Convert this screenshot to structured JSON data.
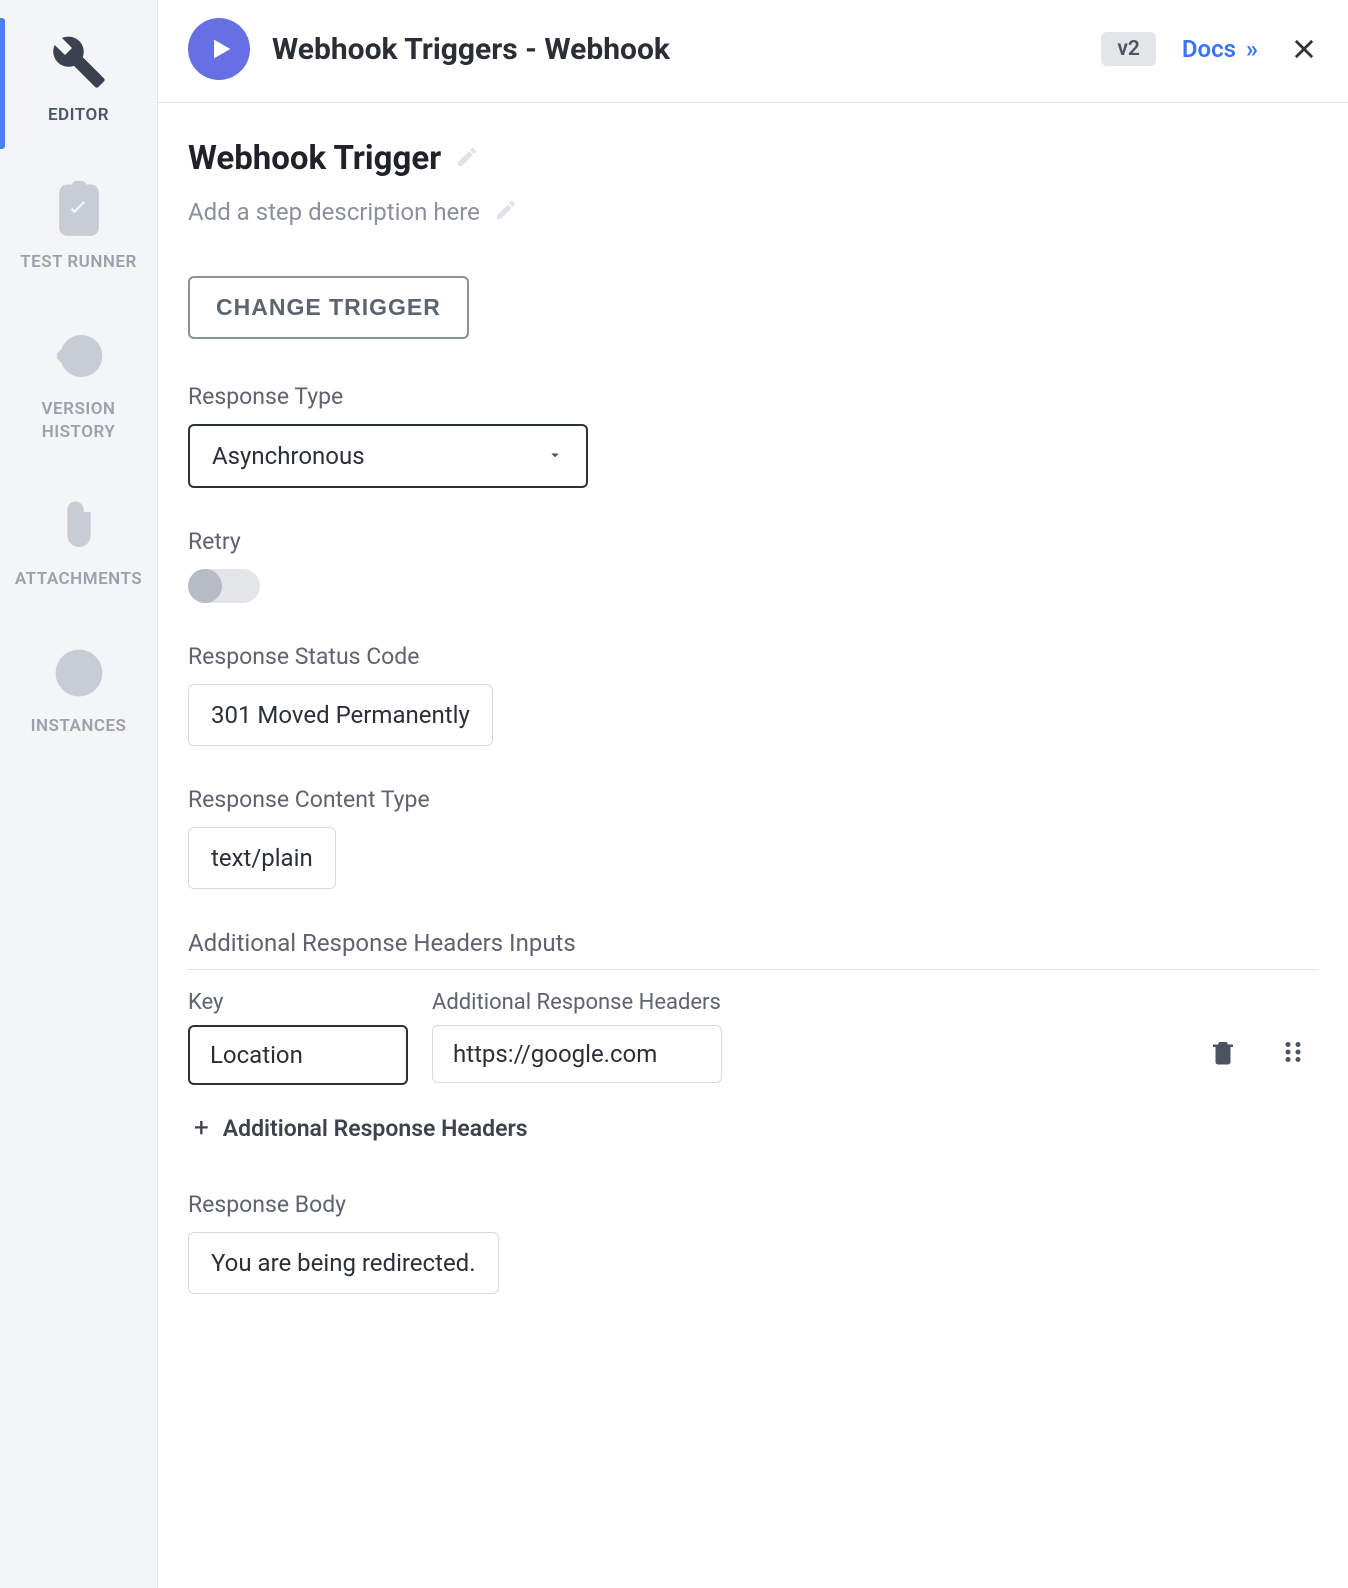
{
  "sidebar": {
    "items": [
      {
        "label": "EDITOR"
      },
      {
        "label": "TEST RUNNER"
      },
      {
        "label": "VERSION HISTORY"
      },
      {
        "label": "ATTACHMENTS"
      },
      {
        "label": "INSTANCES"
      }
    ]
  },
  "header": {
    "title": "Webhook Triggers - Webhook",
    "version": "v2",
    "docs_label": "Docs"
  },
  "main": {
    "section_title": "Webhook Trigger",
    "step_desc_placeholder": "Add a step description here",
    "change_trigger_label": "CHANGE TRIGGER",
    "response_type": {
      "label": "Response Type",
      "value": "Asynchronous"
    },
    "retry": {
      "label": "Retry"
    },
    "response_status_code": {
      "label": "Response Status Code",
      "value": "301 Moved Permanently"
    },
    "response_content_type": {
      "label": "Response Content Type",
      "value": "text/plain"
    },
    "additional_headers": {
      "heading": "Additional Response Headers Inputs",
      "key_label": "Key",
      "value_label": "Additional Response Headers",
      "rows": [
        {
          "key": "Location",
          "value": "https://google.com"
        }
      ],
      "add_more_label": "Additional Response Headers"
    },
    "response_body": {
      "label": "Response Body",
      "value": "You are being redirected."
    }
  }
}
